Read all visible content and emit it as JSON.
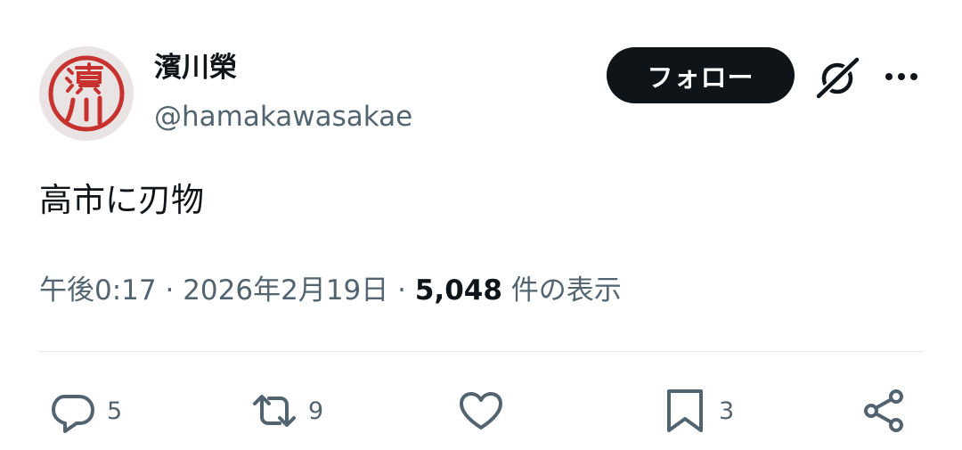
{
  "author": {
    "display_name": "濱川榮",
    "handle": "@hamakawasakae",
    "avatar_seal_text": "濱川"
  },
  "header": {
    "follow_label": "フォロー",
    "grok_icon": "grok-icon",
    "more_icon": "more-icon"
  },
  "tweet": {
    "text": "高市に刃物",
    "time": "午後0:17",
    "date": "2026年2月19日",
    "views_count": "5,048",
    "views_label": "件の表示"
  },
  "actions": {
    "replies": "5",
    "retweets": "9",
    "bookmarks": "3"
  },
  "colors": {
    "text_primary": "#0f1419",
    "text_secondary": "#536471",
    "follow_bg": "#0f1419",
    "seal_red": "#c8322e",
    "divider": "#e6e9ec"
  }
}
